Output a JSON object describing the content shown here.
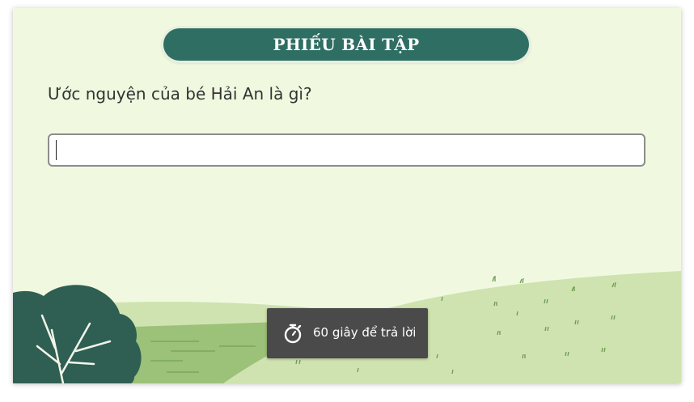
{
  "worksheet": {
    "title": "PHIẾU BÀI TẬP",
    "question": "Ước nguyện của bé Hải An là gì?",
    "answer_value": "",
    "answer_placeholder": ""
  },
  "timer": {
    "icon": "stopwatch-icon",
    "label": "60 giây để trả lời"
  },
  "colors": {
    "background": "#f0f9e0",
    "accent": "#2f6e63",
    "timer_bg": "#4a4a4a"
  }
}
